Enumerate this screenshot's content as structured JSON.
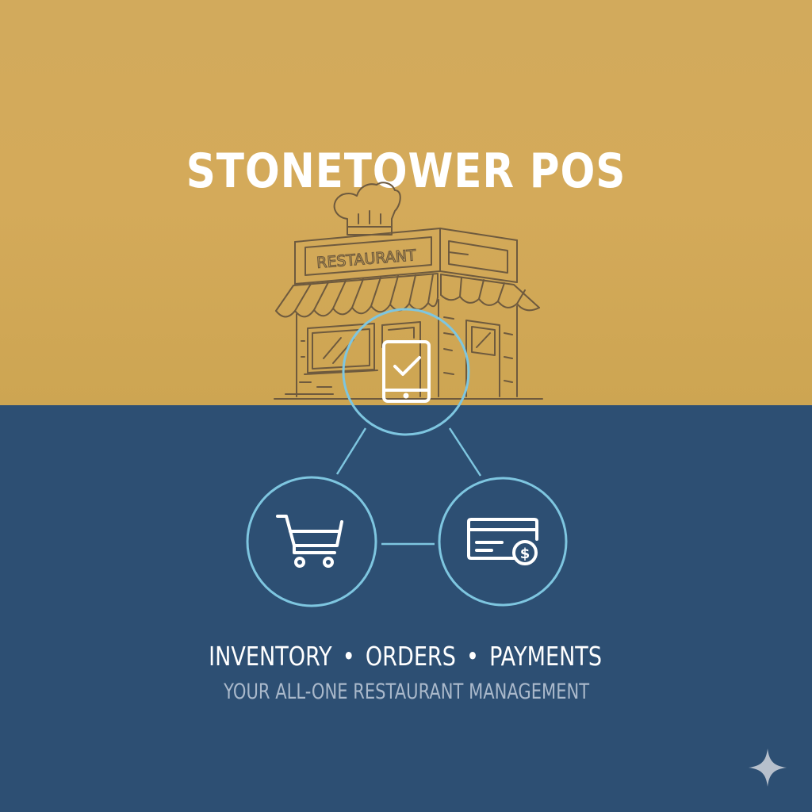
{
  "brand": {
    "title": "STONETOWER POS",
    "storefront_sign": "RESTAURANT"
  },
  "features": {
    "items": [
      "INVENTORY",
      "ORDERS",
      "PAYMENTS"
    ],
    "separator": "•"
  },
  "tagline": "YOUR ALL-ONE RESTAURANT MANAGEMENT",
  "icons": [
    "chef-hat-icon",
    "storefront-icon",
    "tablet-check-icon",
    "shopping-cart-icon",
    "credit-card-dollar-icon",
    "sparkle-icon"
  ],
  "colors": {
    "top_background": "#d4aa5a",
    "bottom_background": "#2d4f73",
    "line_art": "#6e5a3e",
    "circle_outline": "#7ec6e0",
    "text_primary": "#ffffff",
    "text_secondary": "#aab9cb"
  }
}
